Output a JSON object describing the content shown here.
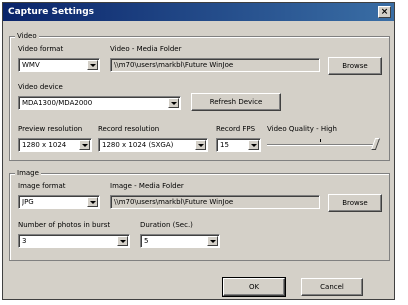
{
  "window": {
    "title": "Capture Settings",
    "close_glyph": "×"
  },
  "video": {
    "group_label": "Video",
    "format_label": "Video format",
    "format_value": "WMV",
    "folder_label": "Video - Media Folder",
    "folder_value": "\\\\m70\\users\\markbl\\Future WinJoe",
    "browse_label": "Browse",
    "device_label": "Video device",
    "device_value": "MDA1300/MDA2000",
    "refresh_label": "Refresh Device",
    "preview_res_label": "Preview resolution",
    "preview_res_value": "1280 x 1024",
    "record_res_label": "Record resolution",
    "record_res_value": "1280 x 1024 (SXGA)",
    "fps_label": "Record FPS",
    "fps_value": "15",
    "quality_label": "Video Quality - High"
  },
  "image": {
    "group_label": "Image",
    "format_label": "Image format",
    "format_value": "JPG",
    "folder_label": "Image - Media Folder",
    "folder_value": "\\\\m70\\users\\markbl\\Future WinJoe",
    "browse_label": "Browse",
    "burst_label": "Number of photos in burst",
    "burst_value": "3",
    "duration_label": "Duration (Sec.)",
    "duration_value": "5"
  },
  "footer": {
    "ok_label": "OK",
    "cancel_label": "Cancel"
  }
}
